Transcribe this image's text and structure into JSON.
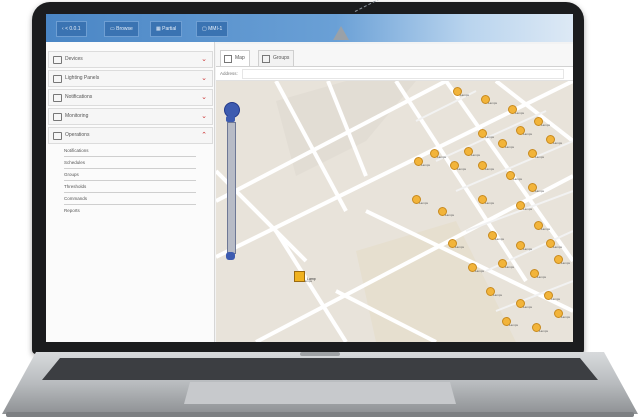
{
  "topbar": {
    "items": [
      {
        "label": "< 0.0.1",
        "icon": "back-icon"
      },
      {
        "label": "Browse",
        "icon": "folder-icon"
      },
      {
        "label": "Partial",
        "icon": "grid-icon"
      },
      {
        "label": "MMI-1",
        "icon": "window-icon"
      }
    ]
  },
  "sidebar": {
    "items": [
      {
        "label": "Devices",
        "icon": "device-icon"
      },
      {
        "label": "Lighting Panels",
        "icon": "panel-icon"
      },
      {
        "label": "Notifications",
        "icon": "bell-icon"
      },
      {
        "label": "Monitoring",
        "icon": "monitor-icon"
      },
      {
        "label": "Operations",
        "icon": "person-icon"
      }
    ],
    "operations_items": [
      "Notifications",
      "Schedules",
      "Groups",
      "Thresholds",
      "Commands",
      "Reports"
    ]
  },
  "tabs": [
    {
      "label": "Map",
      "icon": "map-icon"
    },
    {
      "label": "Groups",
      "icon": "groups-icon"
    }
  ],
  "address": {
    "label": "Address:",
    "value": ""
  },
  "map": {
    "label": "Lamps",
    "highlighted_label": "Lamp",
    "colors": {
      "land": "#e8e3da",
      "road": "#ffffff",
      "park": "#dde8cf",
      "marker": "#f2b43a"
    }
  },
  "colors": {
    "topbar": "#4a86c5",
    "chevron": "#cc3333",
    "zoom": "#3d5bb0"
  }
}
